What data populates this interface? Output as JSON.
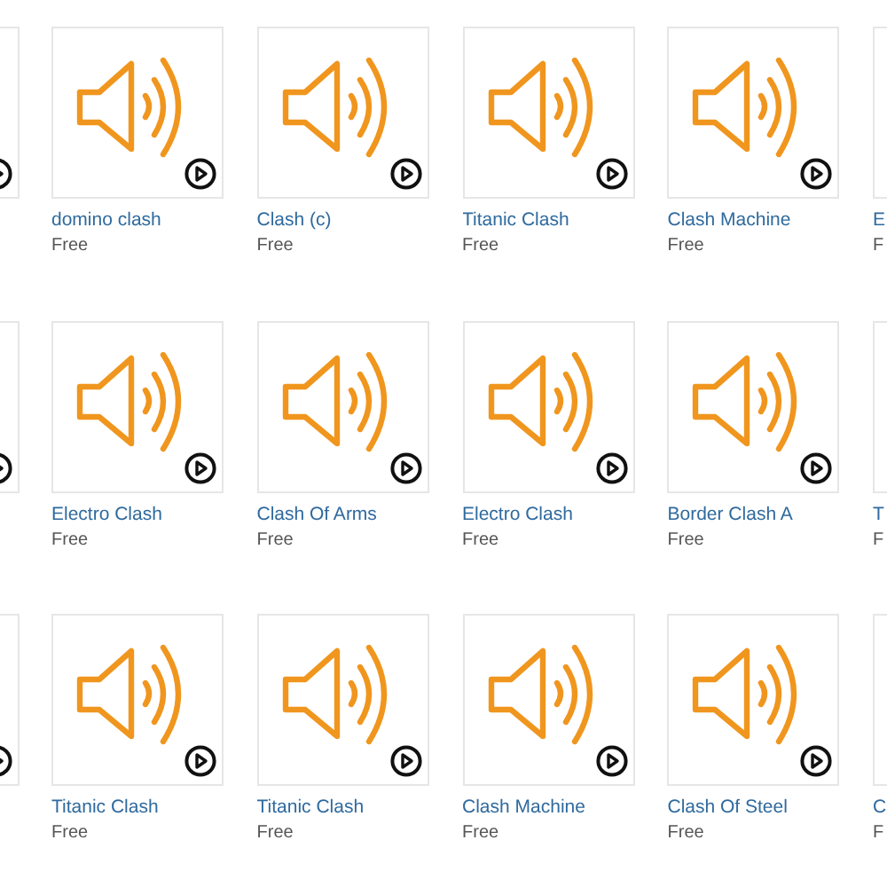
{
  "rows": [
    {
      "cards": [
        {
          "kind": "cut"
        },
        {
          "kind": "card",
          "title": "domino clash",
          "price": "Free"
        },
        {
          "kind": "card",
          "title": "Clash (c)",
          "price": "Free"
        },
        {
          "kind": "card",
          "title": "Titanic Clash",
          "price": "Free"
        },
        {
          "kind": "card",
          "title": "Clash Machine",
          "price": "Free"
        },
        {
          "kind": "card",
          "title": "E",
          "price": "F"
        }
      ]
    },
    {
      "cards": [
        {
          "kind": "cut"
        },
        {
          "kind": "card",
          "title": "Electro Clash",
          "price": "Free"
        },
        {
          "kind": "card",
          "title": "Clash Of Arms",
          "price": "Free"
        },
        {
          "kind": "card",
          "title": "Electro Clash",
          "price": "Free"
        },
        {
          "kind": "card",
          "title": "Border Clash A",
          "price": "Free"
        },
        {
          "kind": "card",
          "title": "T",
          "price": "F"
        }
      ]
    },
    {
      "cards": [
        {
          "kind": "cut"
        },
        {
          "kind": "card",
          "title": "Titanic Clash",
          "price": "Free"
        },
        {
          "kind": "card",
          "title": "Titanic Clash",
          "price": "Free"
        },
        {
          "kind": "card",
          "title": "Clash Machine",
          "price": "Free"
        },
        {
          "kind": "card",
          "title": "Clash Of Steel",
          "price": "Free"
        },
        {
          "kind": "card",
          "title": "C",
          "price": "F"
        }
      ]
    }
  ]
}
